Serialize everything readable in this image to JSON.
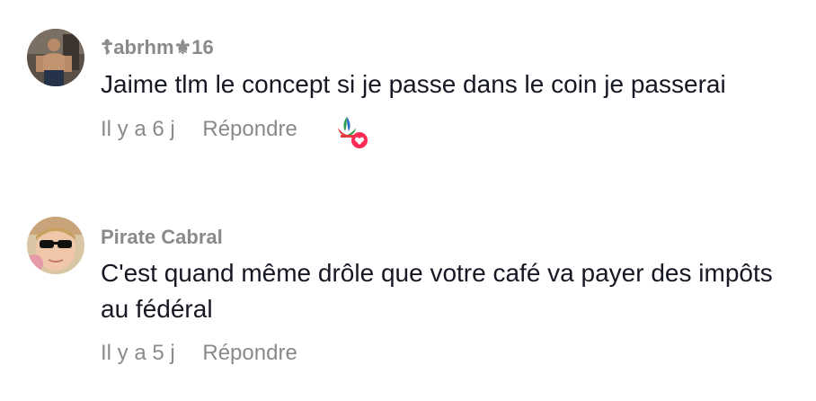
{
  "comments": [
    {
      "username": "☦abrhm⚜16",
      "text": "Jaime tlm le concept si je passe dans le coin je passerai",
      "time": "Il y a 6 j",
      "reply_label": "Répondre",
      "reaction_icon": "fleur-de-lis-heart-icon"
    },
    {
      "username": "Pirate Cabral",
      "text": "C'est quand même drôle que votre café va payer des impôts au fédéral",
      "time": "Il y a 5 j",
      "reply_label": "Répondre"
    }
  ],
  "colors": {
    "secondary_text": "#8a8a8a",
    "primary_text": "#161823",
    "reaction_heart": "#fe2c55",
    "reaction_green": "#2e9e48",
    "reaction_blue": "#2a6fc9",
    "reaction_red": "#e23b3b"
  }
}
